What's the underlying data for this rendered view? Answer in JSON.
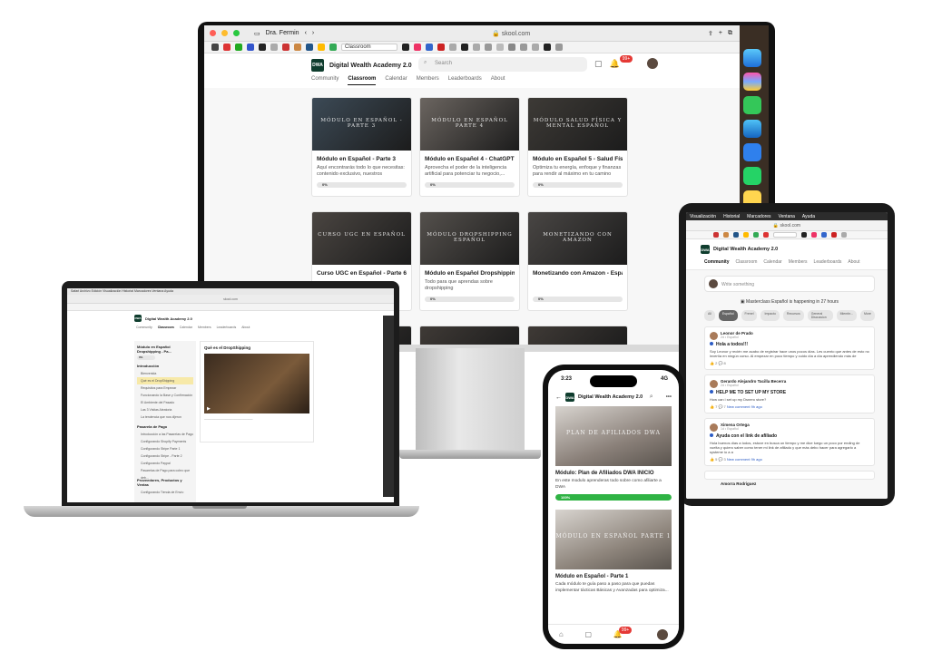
{
  "imac": {
    "profile": "Dra. Fermin",
    "url": "skool.com",
    "active_tab": "Classroom",
    "community_name": "Digital Wealth Academy 2.0",
    "search_placeholder": "Search",
    "notification_count": "99+",
    "nav": [
      "Community",
      "Classroom",
      "Calendar",
      "Members",
      "Leaderboards",
      "About"
    ],
    "active_nav": "Classroom",
    "courses": [
      {
        "thumb_text": "Módulo en Español - Parte 3",
        "title": "Módulo en Español - Parte 3",
        "desc": "Aquí encontrarás todo lo que necesitas: contenido exclusivo, nuestros productos...",
        "progress": "0%",
        "fraction": 0.0,
        "thumb_color": "#3c4a56"
      },
      {
        "thumb_text": "Módulo en Español Parte 4",
        "title": "Módulo en Español 4 - ChatGPT",
        "desc": "Aprovecha el poder de la inteligencia artificial para potenciar tu negocio,...",
        "progress": "0%",
        "fraction": 0.0,
        "thumb_color": "#6b6560"
      },
      {
        "thumb_text": "Módulo Salud Física y Mental Español",
        "title": "Módulo en Español 5 - Salud Físic...",
        "desc": "Optimiza tu energía, enfoque y finanzas para rendir al máximo en tu camino hacia el éxito.",
        "progress": "0%",
        "fraction": 0.0,
        "thumb_color": "#3d3a36"
      },
      {
        "thumb_text": "Curso UGC en Español",
        "title": "Curso UGC en Español - Parte 6",
        "desc": "",
        "progress": "",
        "fraction": 0.0,
        "thumb_color": "#4a4541"
      },
      {
        "thumb_text": "Módulo Dropshipping Español",
        "title": "Módulo en Español Dropshipping ...",
        "desc": "Todo para que aprendas sobre dropshipping",
        "progress": "0%",
        "fraction": 0.0,
        "thumb_color": "#54504c"
      },
      {
        "thumb_text": "Monetizando con Amazon",
        "title": "Monetizando con Amazon - Espa...",
        "desc": "",
        "progress": "0%",
        "fraction": 0.0,
        "thumb_color": "#494644"
      }
    ]
  },
  "macbook": {
    "url": "skool.com",
    "community_name": "Digital Wealth Academy 2.0",
    "nav": [
      "Community",
      "Classroom",
      "Calendar",
      "Members",
      "Leaderboards",
      "About"
    ],
    "active_nav": "Classroom",
    "course_title": "Módulo en Español Dropshipping - Pa...",
    "progress": "0%",
    "section_intro": "Introducción",
    "lessons_intro": [
      "Bienvenida",
      "Qué es el DropShipping",
      "Requisitos para Empezar",
      "Funcionando la Base y Confirmación",
      "El Ambiente del Pasado",
      "Las 3 Visitas Aleatoria",
      "La tendencia que nos dijeron"
    ],
    "selected_lesson": "Qué es el DropShipping",
    "section_payments": "Pasarela de Pago",
    "lessons_payments": [
      "Introducción a las Pasarelas de Pago",
      "Configurando Shopify Payments",
      "Configurando Stripe Parte 1",
      "Configurando Stripe - Parte 2",
      "Configurando Paypal",
      "Pasarelas de Pago para cobro que deb..."
    ],
    "section_products": "Proveedores, Productos y Ventas",
    "lessons_products": [
      "Configurando Tienda de Envío"
    ],
    "lesson_title": "Qué es el DropShipping"
  },
  "ipad": {
    "menu": [
      "Visualización",
      "Historial",
      "Marcadores",
      "Ventana",
      "Ayuda"
    ],
    "url": "skool.com",
    "community_name": "Digital Wealth Academy 2.0",
    "nav": [
      "Community",
      "Classroom",
      "Calendar",
      "Members",
      "Leaderboards",
      "About"
    ],
    "active_nav": "Community",
    "write_placeholder": "Write something",
    "live_text": "Masterclass Español is happening in 27 hours",
    "chips": [
      "All",
      "Español",
      "Frenel",
      "Impacto",
      "Recursos",
      "General Discussion",
      "Miembr...",
      "More"
    ],
    "active_chip": "Español",
    "posts": [
      {
        "author": "Leonor de Prado",
        "meta": "2d • Español",
        "title": "Hola a todos!!!",
        "body": "Soy Leonor y recién me acabo de registrar hace unos pocos días. Les cuento que antes de esto no invertía en ningún curso. Al empezar en poco tiempo y cuido día a día aprendiendo más de",
        "likes": "2",
        "comments": "8",
        "link": ""
      },
      {
        "author": "Gerardo Alejandro Tacilla Becerra",
        "meta": "2d • Español",
        "title": "HELP ME TO SET UP MY STORE",
        "body": "How can i set up my Dsnero store?",
        "likes": "7",
        "comments": "7",
        "link": "New comment 9h ago"
      },
      {
        "author": "Ximena Ortega",
        "meta": "1d • Español",
        "title": "Ayuda con el link de afiliado",
        "body": "Hola buenos días a todos, estuve en busca un tiempo y me dice luego un poco por ending de vuelta y quiero saber como tener mi link de afiliado y que más debo hacer para agregarlo a systeme io a a",
        "likes": "5",
        "comments": "3",
        "link": "New comment 9h ago"
      }
    ],
    "next_author": "Amorra Rodriguez"
  },
  "iphone": {
    "time": "3:23",
    "signal": "4G",
    "community_name": "Digital Wealth Academy 2.0",
    "notification_count": "99+",
    "cards": [
      {
        "thumb_text": "Plan de Afiliados DWA",
        "title": "Módulo: Plan de Afiliados DWA INICIO",
        "desc": "En este modulo aprenderas todo sobre como afiliarte a DWA",
        "progress": "100%",
        "fraction": 1.0,
        "thumb_color": "#8a8079"
      },
      {
        "thumb_text": "Módulo en Español Parte 1",
        "title": "Módulo en Español - Parte 1",
        "desc": "Cada módulo te guía paso a paso para que puedas implementar tácticas Básicas y Avanzadas para optimiza...",
        "progress": "",
        "fraction": 0.0,
        "thumb_color": "#8e857c"
      }
    ]
  },
  "colors": {
    "brand": "#0f3d2e",
    "progress_green": "#2fb344",
    "notification_red": "#e53935",
    "link_blue": "#2c5cc5"
  }
}
